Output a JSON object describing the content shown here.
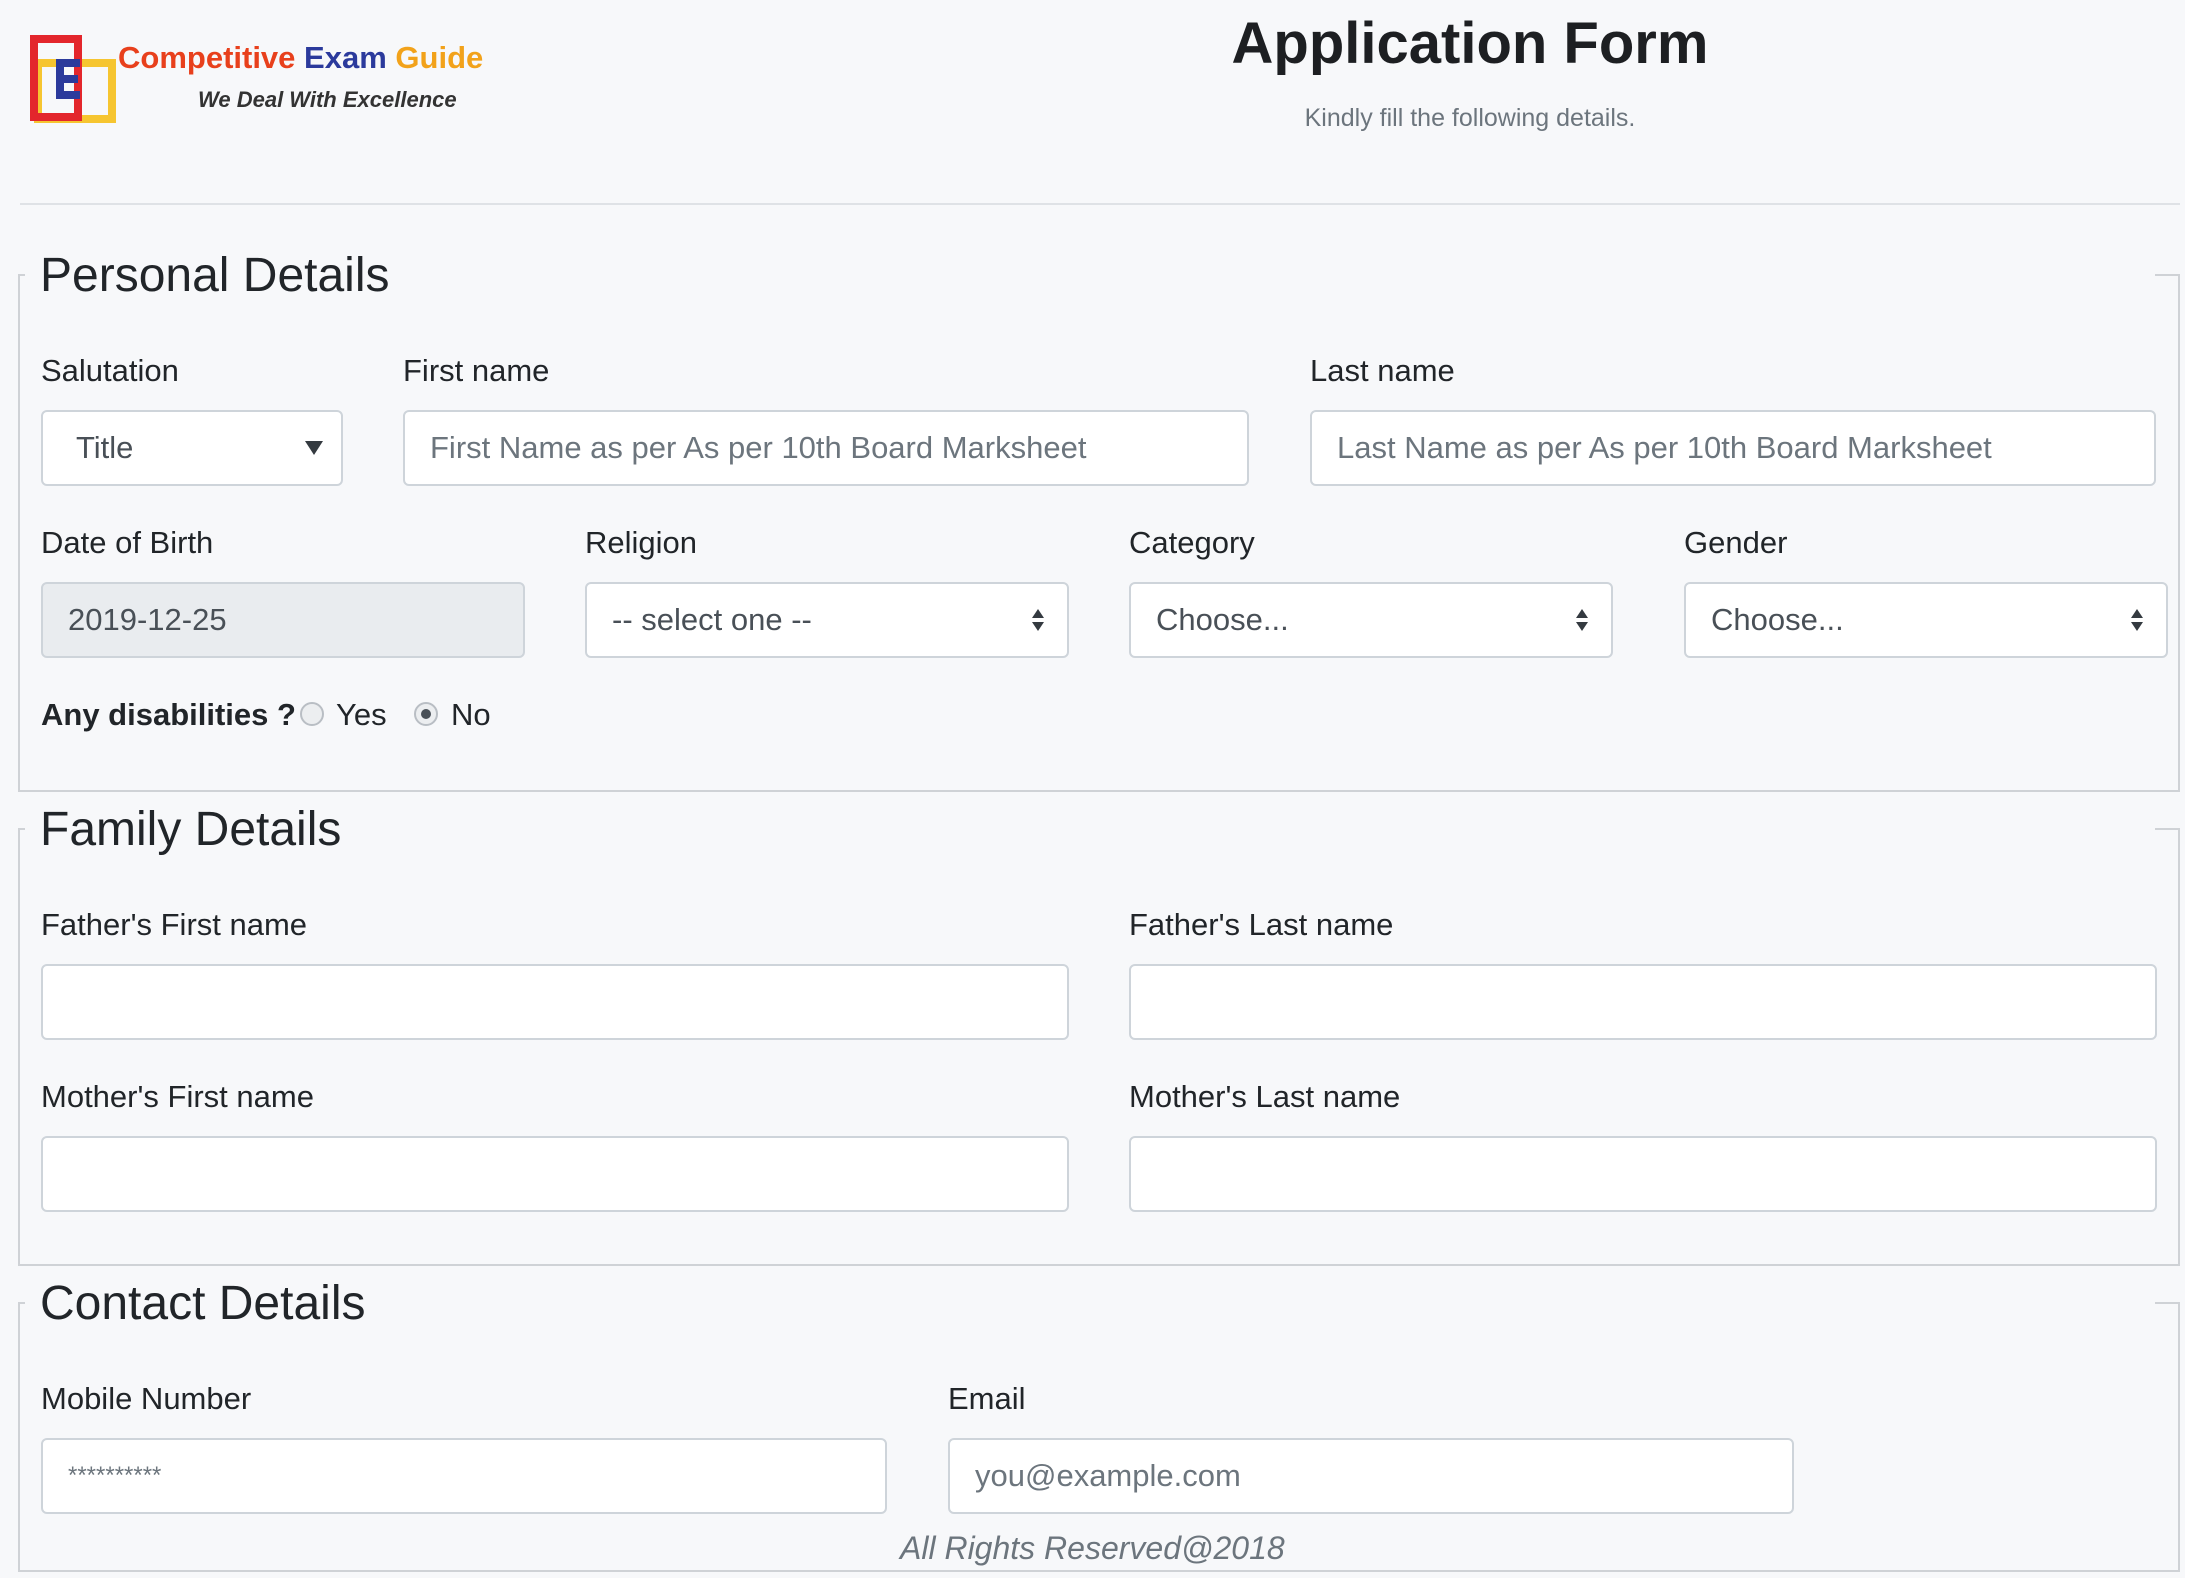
{
  "header": {
    "brand_word1": "Competitive",
    "brand_word2": "Exam",
    "brand_word3": "Guide",
    "tagline": "We Deal With Excellence",
    "title": "Application Form",
    "subtitle": "Kindly fill the following details."
  },
  "personal": {
    "legend": "Personal Details",
    "salutation_label": "Salutation",
    "salutation_value": "Title",
    "first_name_label": "First name",
    "first_name_placeholder": "First Name as per As per 10th Board Marksheet",
    "last_name_label": "Last name",
    "last_name_placeholder": "Last Name as per As per 10th Board Marksheet",
    "dob_label": "Date of Birth",
    "dob_value": "2019-12-25",
    "religion_label": "Religion",
    "religion_value": "-- select one --",
    "category_label": "Category",
    "category_value": "Choose...",
    "gender_label": "Gender",
    "gender_value": "Choose...",
    "disabilities_label": "Any disabilities ?",
    "yes_label": "Yes",
    "no_label": "No",
    "disabilities_selected": "No"
  },
  "family": {
    "legend": "Family Details",
    "father_first_label": "Father's First name",
    "father_last_label": "Father's Last name",
    "mother_first_label": "Mother's First name",
    "mother_last_label": "Mother's Last name"
  },
  "contact": {
    "legend": "Contact Details",
    "mobile_label": "Mobile Number",
    "mobile_placeholder": "**********",
    "email_label": "Email",
    "email_placeholder": "you@example.com"
  },
  "footer": {
    "text": "All Rights Reserved@2018"
  },
  "colors": {
    "background": "#f7f8fa",
    "brand_red": "#e8401c",
    "brand_blue": "#2b3a9c",
    "brand_yellow": "#f2a21a",
    "border": "#ced4da",
    "disabled_bg": "#e9ecef"
  }
}
